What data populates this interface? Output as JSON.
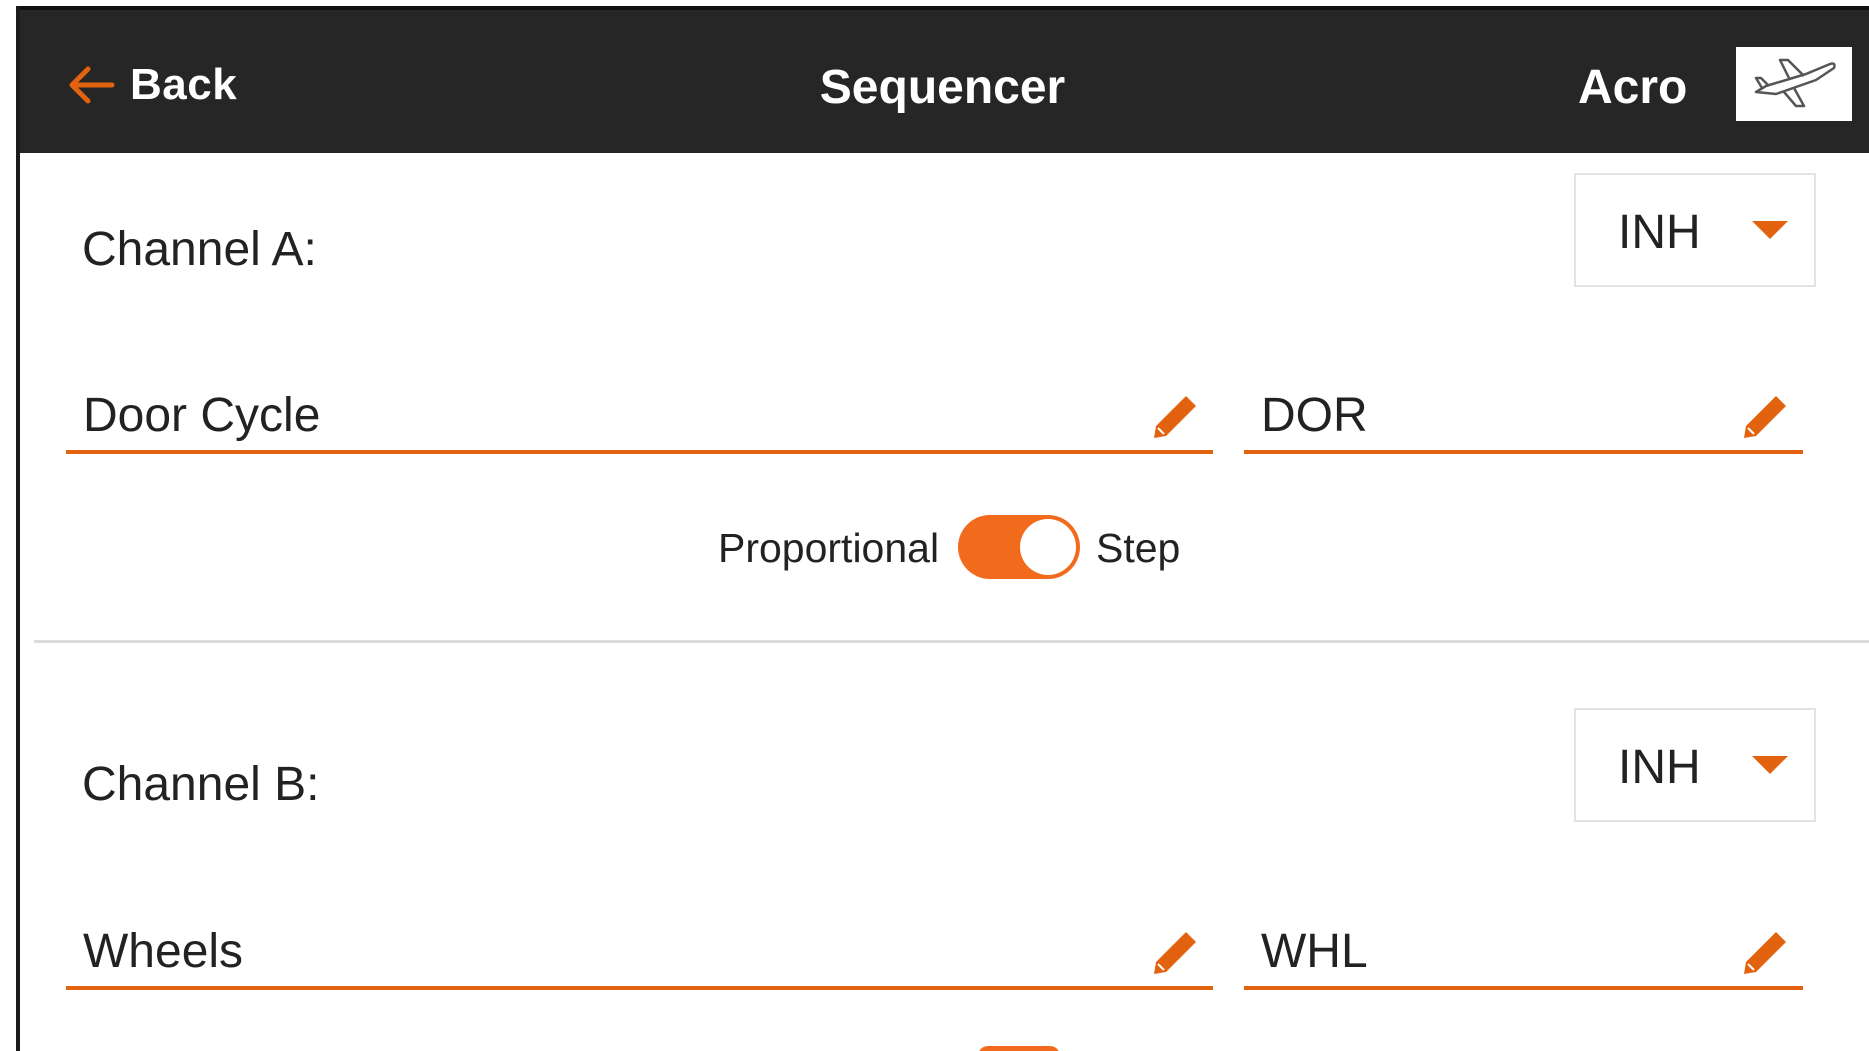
{
  "header": {
    "back_label": "Back",
    "title": "Sequencer",
    "model_type": "Acro",
    "model_icon": "airplane-icon"
  },
  "channels": [
    {
      "label": "Channel A:",
      "switch_value": "INH",
      "name": "Door Cycle",
      "short_name": "DOR",
      "toggle_left": "Proportional",
      "toggle_right": "Step",
      "toggle_state": "Step"
    },
    {
      "label": "Channel B:",
      "switch_value": "INH",
      "name": "Wheels",
      "short_name": "WHL"
    }
  ],
  "colors": {
    "accent": "#e2620f",
    "header_bg": "#262626",
    "toggle_on": "#f26a1b"
  },
  "icons": {
    "back": "back-arrow-icon",
    "edit": "pencil-icon",
    "dropdown": "caret-down-icon"
  }
}
